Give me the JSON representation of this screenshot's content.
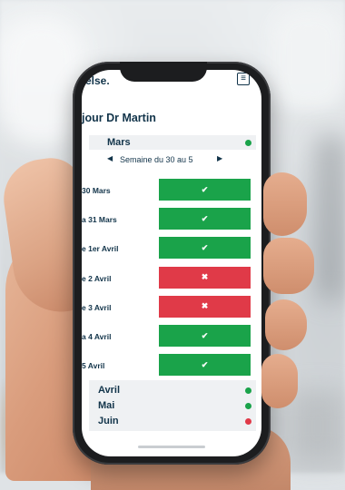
{
  "app": {
    "brand": "else.",
    "menu_icon": "hamburger-icon"
  },
  "greeting": "jour Dr Martin",
  "current_month": {
    "label": "Mars",
    "status_color": "#1aa34a"
  },
  "week": {
    "label": "Semaine du 30 au 5",
    "prev_icon": "caret-left-icon",
    "next_icon": "caret-right-icon"
  },
  "days": [
    {
      "label": "30 Mars",
      "status": "ok",
      "symbol": "✔",
      "color": "#1aa34a"
    },
    {
      "label": "a 31 Mars",
      "status": "ok",
      "symbol": "✔",
      "color": "#1aa34a"
    },
    {
      "label": "e 1er Avril",
      "status": "ok",
      "symbol": "✔",
      "color": "#1aa34a"
    },
    {
      "label": "e 2 Avril",
      "status": "ko",
      "symbol": "✖",
      "color": "#e03a48"
    },
    {
      "label": "e 3 Avril",
      "status": "ko",
      "symbol": "✖",
      "color": "#e03a48"
    },
    {
      "label": "a 4 Avril",
      "status": "ok",
      "symbol": "✔",
      "color": "#1aa34a"
    },
    {
      "label": "5 Avril",
      "status": "ok",
      "symbol": "✔",
      "color": "#1aa34a"
    }
  ],
  "other_months": [
    {
      "label": "Avril",
      "status_color": "#1aa34a"
    },
    {
      "label": "Mai",
      "status_color": "#1aa34a"
    },
    {
      "label": "Juin",
      "status_color": "#e03a48"
    }
  ]
}
